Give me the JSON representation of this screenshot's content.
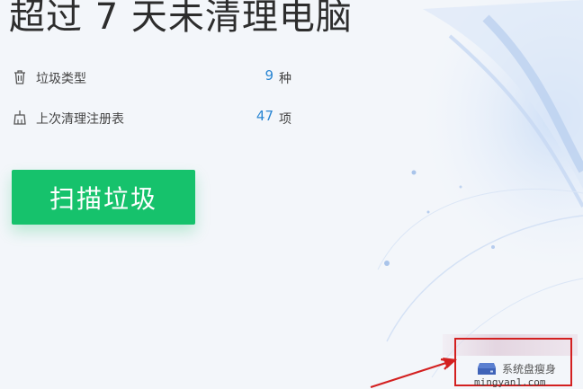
{
  "header": {
    "headline": "超过 7 天未清理电脑"
  },
  "stats": [
    {
      "icon": "trash-icon",
      "label": "垃圾类型",
      "value": "9",
      "unit": "种"
    },
    {
      "icon": "broom-icon",
      "label": "上次清理注册表",
      "value": "47",
      "unit": "项"
    }
  ],
  "actions": {
    "scan_label": "扫描垃圾"
  },
  "footer": {
    "system_disk_label": "系统盘瘦身",
    "system_disk_icon": "disk-icon"
  },
  "watermark": "mingyan1.com",
  "colors": {
    "accent_green": "#16c26c",
    "stat_number_blue": "#2a86d3",
    "annotation_red": "#d32020"
  }
}
